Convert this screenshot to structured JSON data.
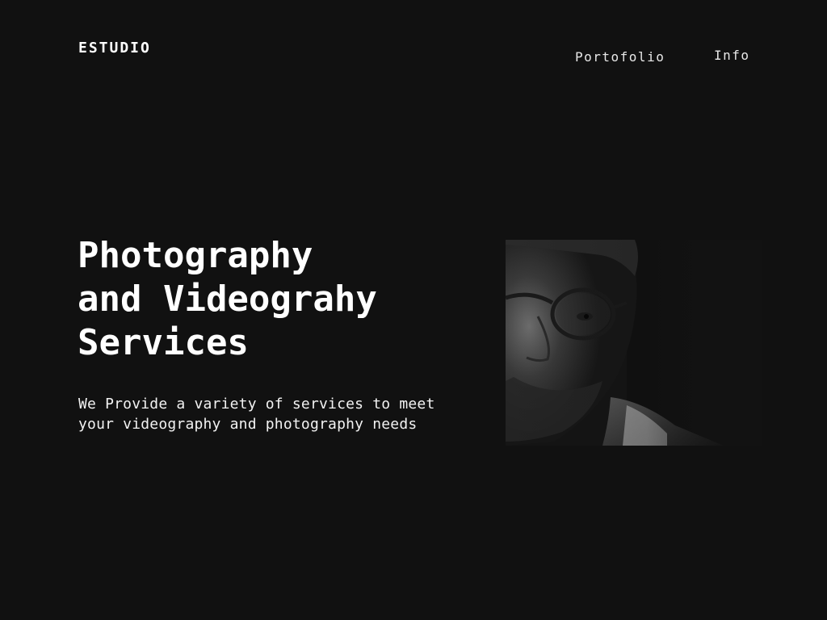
{
  "brand": {
    "name": "ESTUDIO"
  },
  "nav": {
    "items": [
      {
        "label": "Portofolio"
      },
      {
        "label": "Info"
      }
    ]
  },
  "hero": {
    "title_lines": [
      "Photography",
      "and Videograhy",
      "Services"
    ],
    "subtitle_lines": [
      "We Provide a variety of services to meet",
      "your videography and photography needs"
    ],
    "image": "portrait-photo"
  },
  "colors": {
    "background": "#111111",
    "text": "#ffffff",
    "nav_text": "#e8e8e8"
  }
}
